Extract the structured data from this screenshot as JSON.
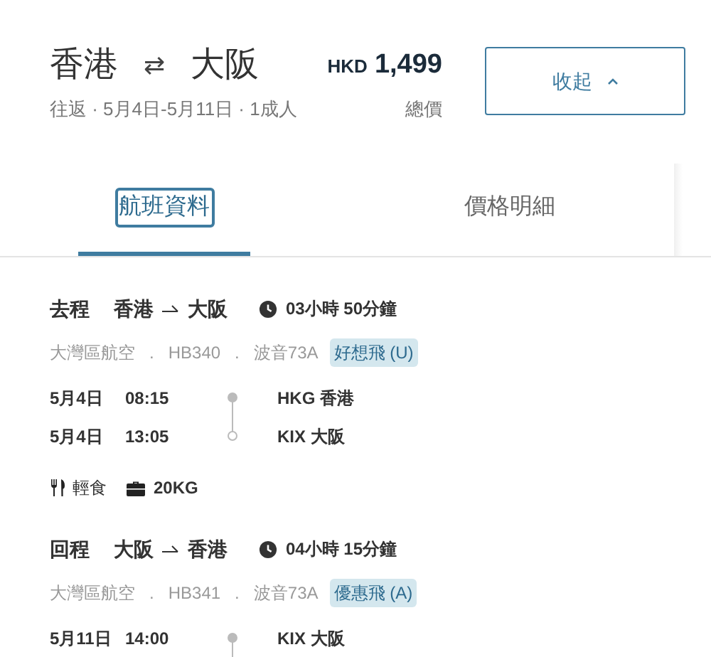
{
  "header": {
    "origin": "香港",
    "swap_icon": "⇄",
    "destination": "大阪",
    "currency": "HKD",
    "price": "1,499",
    "trip_info": "往返 · 5月4日-5月11日 · 1成人",
    "price_label": "總價",
    "collapse_button": "收起"
  },
  "tabs": [
    {
      "label": "航班資料",
      "selected": true
    },
    {
      "label": "價格明細",
      "selected": false
    }
  ],
  "segments": [
    {
      "label": "去程",
      "from": "香港",
      "to": "大阪",
      "duration": "03小時 50分鐘",
      "details": [
        "大灣區航空",
        ".",
        "HB340",
        ".",
        "波音73A"
      ],
      "fare_class": "好想飛 (U)",
      "stops": [
        {
          "kind": "departure",
          "date": "5月4日",
          "time": "08:15",
          "airport": "HKG 香港"
        },
        {
          "kind": "arrival",
          "date": "5月4日",
          "time": "13:05",
          "airport": "KIX 大阪"
        }
      ],
      "meal": "輕食",
      "baggage": "20KG"
    },
    {
      "label": "回程",
      "from": "大阪",
      "to": "香港",
      "duration": "04小時 15分鐘",
      "details": [
        "大灣區航空",
        ".",
        "HB341",
        ".",
        "波音73A"
      ],
      "fare_class": "優惠飛 (A)",
      "stops": [
        {
          "kind": "departure",
          "date": "5月11日",
          "time": "14:00",
          "airport": "KIX 大阪"
        }
      ]
    }
  ]
}
